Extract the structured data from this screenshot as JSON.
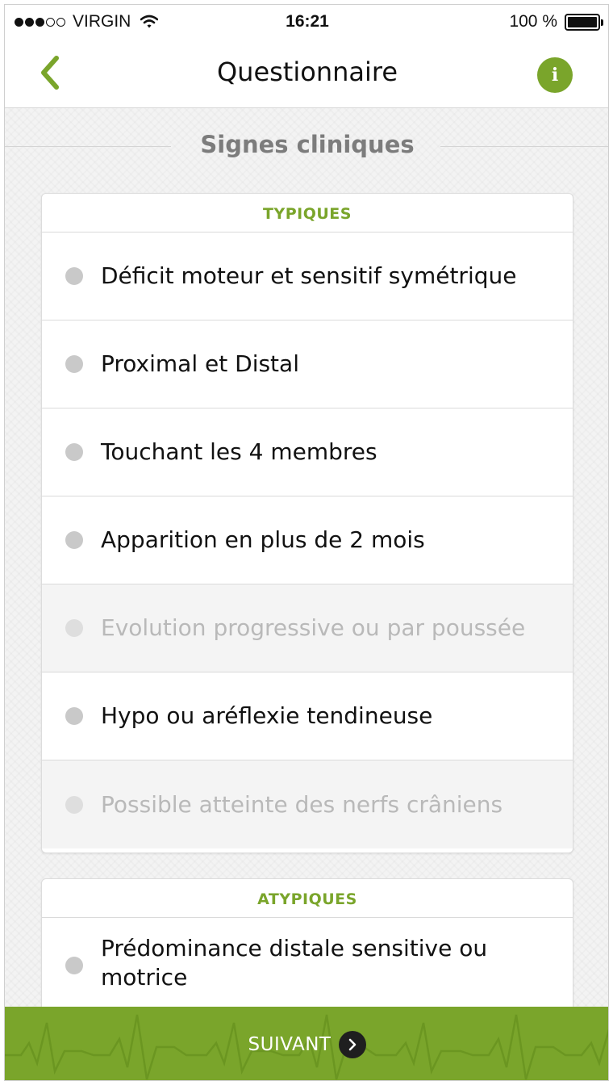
{
  "status_bar": {
    "carrier": "VIRGIN",
    "time": "16:21",
    "battery": "100 %",
    "signal_bars_filled": 3,
    "signal_bars_total": 5
  },
  "nav": {
    "title": "Questionnaire",
    "info_label": "i",
    "icons": {
      "back": "chevron-left-icon",
      "info": "info-icon"
    }
  },
  "section": {
    "title": "Signes cliniques"
  },
  "cards": {
    "typiques": {
      "title": "TYPIQUES",
      "items": [
        {
          "label": "Déficit moteur et sensitif symétrique",
          "enabled": true
        },
        {
          "label": "Proximal et Distal",
          "enabled": true
        },
        {
          "label": "Touchant les 4 membres",
          "enabled": true
        },
        {
          "label": "Apparition en plus de 2 mois",
          "enabled": true
        },
        {
          "label": "Evolution progressive ou par poussée",
          "enabled": false
        },
        {
          "label": "Hypo ou aréflexie tendineuse",
          "enabled": true
        },
        {
          "label": "Possible atteinte des nerfs crâniens",
          "enabled": false
        }
      ]
    },
    "atypiques": {
      "title": "ATYPIQUES",
      "items": [
        {
          "label": "Prédominance distale sensitive ou motrice",
          "enabled": true
        }
      ]
    }
  },
  "footer": {
    "next_label": "SUIVANT",
    "next_icon": "chevron-right-icon"
  },
  "colors": {
    "accent": "#7aa52b",
    "heading_gray": "#7c7c7c",
    "radio": "#c9c9c9",
    "disabled_bg": "#f4f4f4",
    "disabled_text": "#b9b9b9"
  }
}
